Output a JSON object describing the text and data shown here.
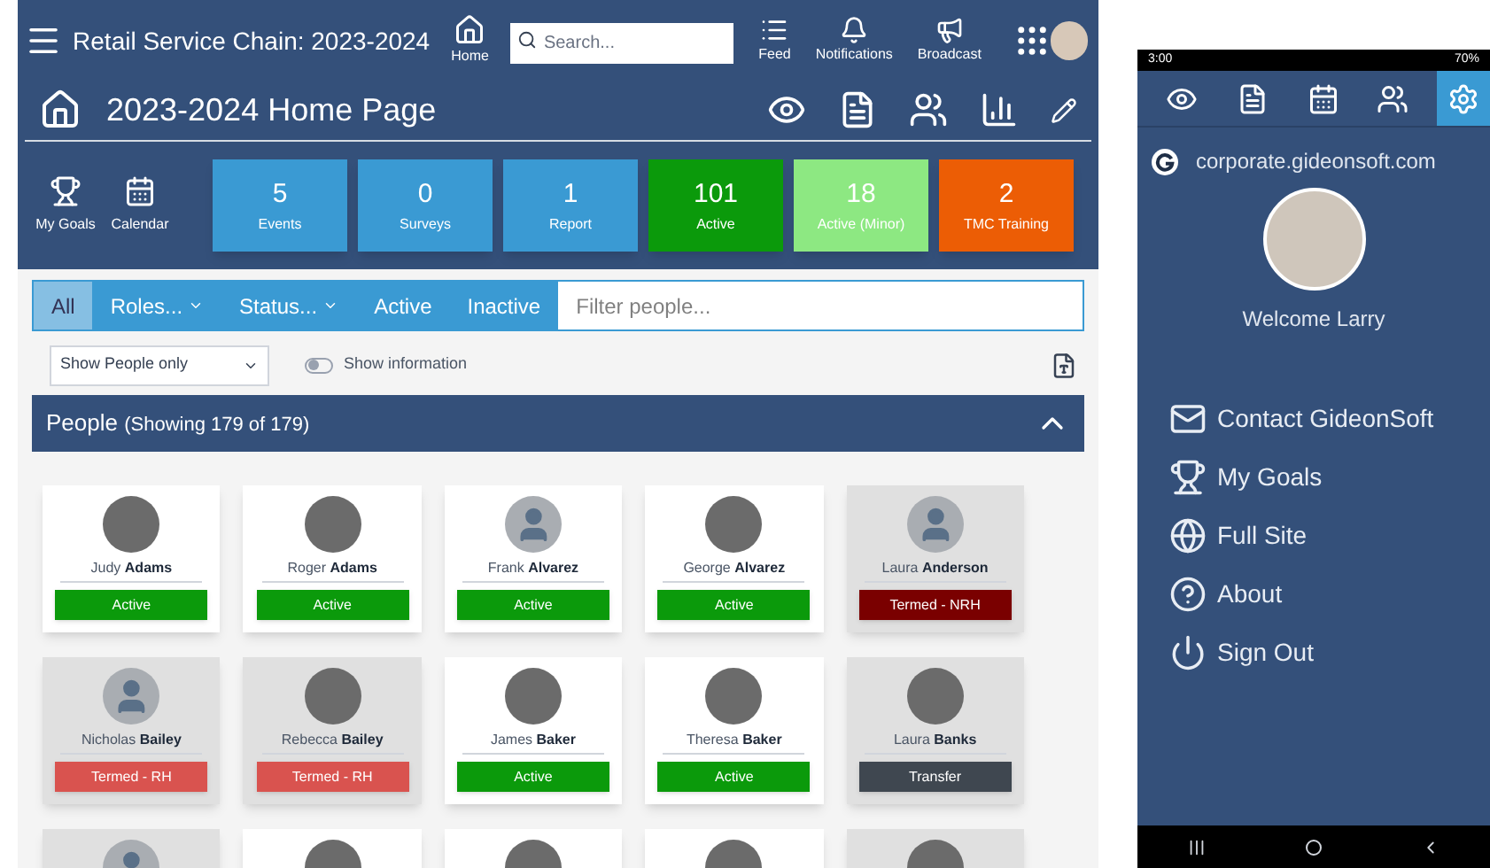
{
  "topbar": {
    "title": "Retail Service Chain: 2023-2024",
    "home": "Home",
    "search": {
      "placeholder": "Search..."
    },
    "actions": [
      {
        "kind": "feed",
        "label": "Feed"
      },
      {
        "kind": "bell",
        "label": "Notifications"
      },
      {
        "kind": "megaphone",
        "label": "Broadcast"
      }
    ]
  },
  "page": {
    "title": "2023-2024 Home Page",
    "tools": [
      {
        "kind": "eye"
      },
      {
        "kind": "doc"
      },
      {
        "kind": "people"
      },
      {
        "kind": "chart"
      },
      {
        "kind": "pencil"
      }
    ]
  },
  "shortcuts": [
    {
      "kind": "trophy",
      "label": "My Goals"
    },
    {
      "kind": "calendar",
      "label": "Calendar"
    }
  ],
  "tiles": [
    {
      "value": "5",
      "label": "Events",
      "color": "#3a9ad3"
    },
    {
      "value": "0",
      "label": "Surveys",
      "color": "#3a9ad3"
    },
    {
      "value": "1",
      "label": "Report",
      "color": "#3a9ad3"
    },
    {
      "value": "101",
      "label": "Active",
      "color": "#0b9a0b"
    },
    {
      "value": "18",
      "label": "Active (Minor)",
      "color": "#8de882"
    },
    {
      "value": "2",
      "label": "TMC Training",
      "color": "#ec5d05"
    }
  ],
  "filters": {
    "tabs": [
      {
        "label": "All",
        "selected": true,
        "kind": "plain"
      },
      {
        "label": "Roles...",
        "selected": false,
        "kind": "dropdown"
      },
      {
        "label": "Status...",
        "selected": false,
        "kind": "dropdown"
      },
      {
        "label": "Active",
        "selected": false,
        "kind": "plain"
      },
      {
        "label": "Inactive",
        "selected": false,
        "kind": "plain"
      }
    ],
    "placeholder": "Filter people...",
    "select": "Show People only",
    "toggle": {
      "label": "Show information",
      "on": false
    }
  },
  "people_panel": {
    "title": "People",
    "count": "(Showing 179 of 179)",
    "expanded": true,
    "people": [
      {
        "first": "Judy",
        "last": "Adams",
        "status": "Active",
        "color": "#0b9a0b",
        "inactive": false,
        "photo": true
      },
      {
        "first": "Roger",
        "last": "Adams",
        "status": "Active",
        "color": "#0b9a0b",
        "inactive": false,
        "photo": true
      },
      {
        "first": "Frank",
        "last": "Alvarez",
        "status": "Active",
        "color": "#0b9a0b",
        "inactive": false,
        "photo": false
      },
      {
        "first": "George",
        "last": "Alvarez",
        "status": "Active",
        "color": "#0b9a0b",
        "inactive": false,
        "photo": true
      },
      {
        "first": "Laura",
        "last": "Anderson",
        "status": "Termed - NRH",
        "color": "#7a0000",
        "inactive": true,
        "photo": false
      },
      {
        "first": "Nicholas",
        "last": "Bailey",
        "status": "Termed - RH",
        "color": "#d9534f",
        "inactive": true,
        "photo": false
      },
      {
        "first": "Rebecca",
        "last": "Bailey",
        "status": "Termed - RH",
        "color": "#d9534f",
        "inactive": true,
        "photo": true
      },
      {
        "first": "James",
        "last": "Baker",
        "status": "Active",
        "color": "#0b9a0b",
        "inactive": false,
        "photo": true
      },
      {
        "first": "Theresa",
        "last": "Baker",
        "status": "Active",
        "color": "#0b9a0b",
        "inactive": false,
        "photo": true
      },
      {
        "first": "Laura",
        "last": "Banks",
        "status": "Transfer",
        "color": "#3f4750",
        "inactive": true,
        "photo": true
      }
    ],
    "partial_row": [
      {
        "inactive": true,
        "photo": false
      },
      {
        "inactive": false,
        "photo": true
      },
      {
        "inactive": false,
        "photo": true
      },
      {
        "inactive": false,
        "photo": true
      },
      {
        "inactive": true,
        "photo": true
      }
    ]
  },
  "phone": {
    "status": {
      "time": "3:00",
      "battery": "70%"
    },
    "tabs": [
      {
        "kind": "eye",
        "selected": false
      },
      {
        "kind": "doc",
        "selected": false
      },
      {
        "kind": "calendar",
        "selected": false
      },
      {
        "kind": "people",
        "selected": false
      },
      {
        "kind": "gear",
        "selected": true
      }
    ],
    "domain": "corporate.gideonsoft.com",
    "welcome": "Welcome Larry",
    "menu": [
      {
        "kind": "mail",
        "label": "Contact GideonSoft"
      },
      {
        "kind": "trophy",
        "label": "My Goals"
      },
      {
        "kind": "globe",
        "label": "Full Site"
      },
      {
        "kind": "help",
        "label": "About"
      },
      {
        "kind": "power",
        "label": "Sign Out"
      }
    ]
  }
}
